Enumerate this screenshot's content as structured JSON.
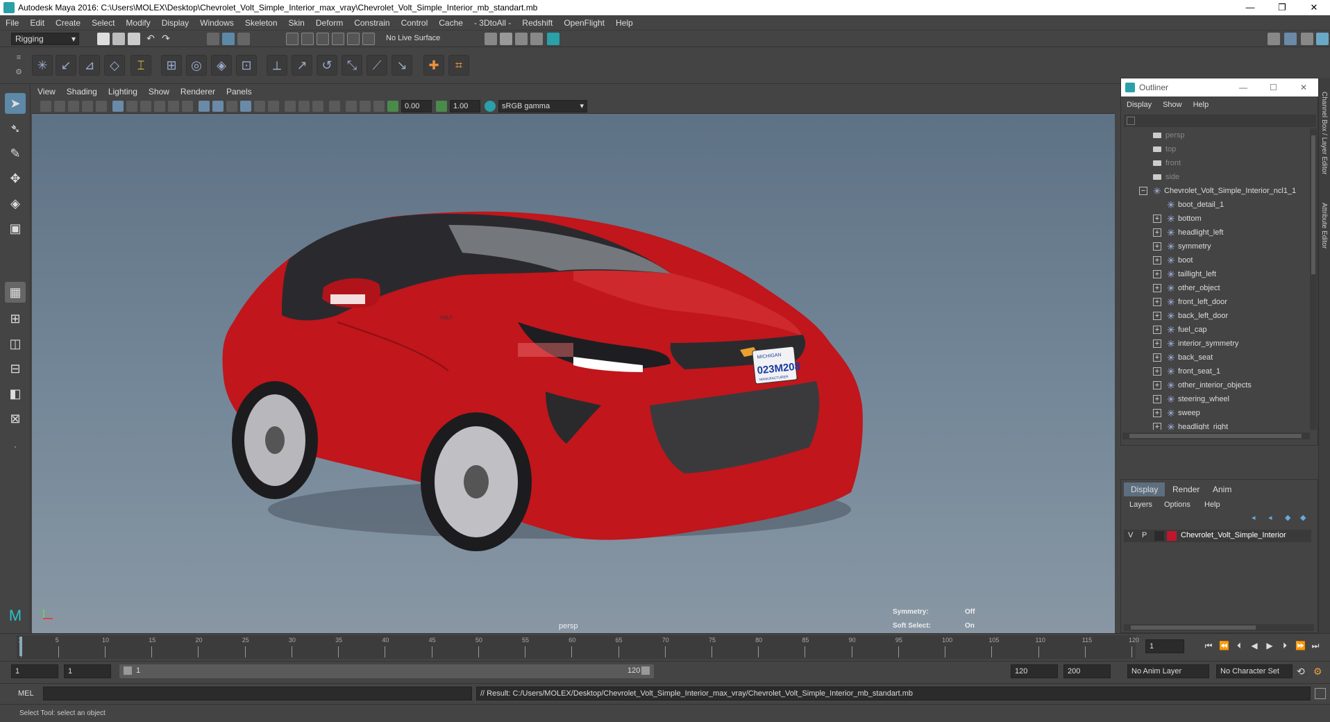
{
  "window": {
    "title": "Autodesk Maya 2016: C:\\Users\\MOLEX\\Desktop\\Chevrolet_Volt_Simple_Interior_max_vray\\Chevrolet_Volt_Simple_Interior_mb_standart.mb",
    "minimize": "—",
    "restore": "❐",
    "close": "✕"
  },
  "menubar": [
    "File",
    "Edit",
    "Create",
    "Select",
    "Modify",
    "Display",
    "Windows",
    "Skeleton",
    "Skin",
    "Deform",
    "Constrain",
    "Control",
    "Cache",
    "- 3DtoAll -",
    "Redshift",
    "OpenFlight",
    "Help"
  ],
  "statusline": {
    "mode": "Rigging",
    "live_surface": "No Live Surface"
  },
  "panel": {
    "menu": [
      "View",
      "Shading",
      "Lighting",
      "Show",
      "Renderer",
      "Panels"
    ],
    "near_value": "0.00",
    "far_value": "1.00",
    "color_space": "sRGB gamma",
    "camera_label": "persp",
    "symmetry_label": "Symmetry:",
    "symmetry_value": "Off",
    "soft_select_label": "Soft Select:",
    "soft_select_value": "On"
  },
  "car": {
    "plate_state": "MICHIGAN",
    "plate_number": "023M208",
    "plate_bottom": "MANUFACTURER",
    "badge": "VOLT"
  },
  "outliner": {
    "title": "Outliner",
    "menu": [
      "Display",
      "Show",
      "Help"
    ],
    "cameras": [
      "persp",
      "top",
      "front",
      "side"
    ],
    "root": "Chevrolet_Volt_Simple_Interior_ncl1_1",
    "first_child": "boot_detail_1",
    "children": [
      "bottom",
      "headlight_left",
      "symmetry",
      "boot",
      "taillight_left",
      "other_object",
      "front_left_door",
      "back_left_door",
      "fuel_cap",
      "interior_symmetry",
      "back_seat",
      "front_seat_1",
      "other_interior_objects",
      "steering_wheel",
      "sweep",
      "headlight_right"
    ]
  },
  "side_tabs": {
    "channel_box": "Channel Box / Layer Editor",
    "attribute_editor": "Attribute Editor"
  },
  "layer_editor": {
    "tabs": [
      "Display",
      "Render",
      "Anim"
    ],
    "menu": [
      "Layers",
      "Options",
      "Help"
    ],
    "layer_v": "V",
    "layer_p": "P",
    "layer_name": "Chevrolet_Volt_Simple_Interior",
    "layer_color": "#c0162c"
  },
  "timeslider": {
    "ticks": [
      "1",
      "5",
      "10",
      "15",
      "20",
      "25",
      "30",
      "35",
      "40",
      "45",
      "50",
      "55",
      "60",
      "65",
      "70",
      "75",
      "80",
      "85",
      "90",
      "95",
      "100",
      "105",
      "110",
      "115",
      "120"
    ],
    "current_frame": "1"
  },
  "rangeslider": {
    "start": "1",
    "playback_start": "1",
    "slider_start": "1",
    "slider_end": "120",
    "playback_end": "120",
    "end": "200",
    "anim_layer": "No Anim Layer",
    "character_set": "No Character Set"
  },
  "cmdline": {
    "lang": "MEL",
    "result": "// Result: C:/Users/MOLEX/Desktop/Chevrolet_Volt_Simple_Interior_max_vray/Chevrolet_Volt_Simple_Interior_mb_standart.mb"
  },
  "helpline": {
    "text": "Select Tool: select an object"
  },
  "colors": {
    "car_red": "#c0161c",
    "accent": "#2aa0a8"
  }
}
